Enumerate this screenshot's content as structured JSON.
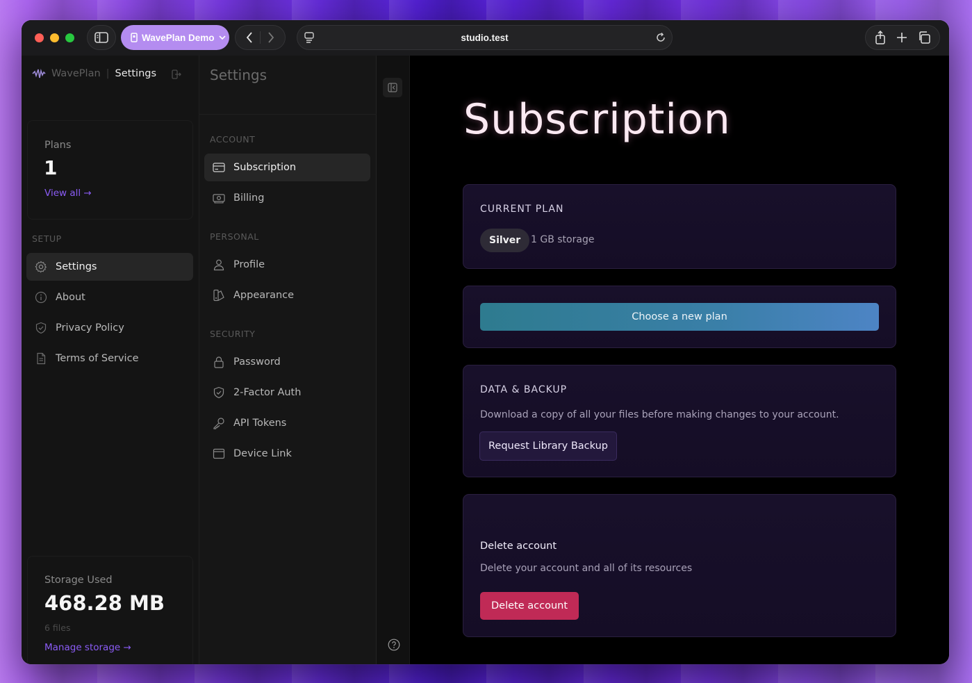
{
  "browser": {
    "tab_group_label": "WavePlan Demo",
    "url": "studio.test"
  },
  "brand": {
    "app_name": "WavePlan",
    "separator": "|",
    "section": "Settings"
  },
  "plans_card": {
    "label": "Plans",
    "value": "1",
    "link": "View all →"
  },
  "setup": {
    "heading": "SETUP",
    "items": [
      {
        "label": "Settings",
        "icon": "gear-icon",
        "active": true
      },
      {
        "label": "About",
        "icon": "info-icon"
      },
      {
        "label": "Privacy Policy",
        "icon": "shield-icon"
      },
      {
        "label": "Terms of Service",
        "icon": "document-icon"
      }
    ]
  },
  "storage_card": {
    "label": "Storage Used",
    "value": "468.28 MB",
    "files": "6 files",
    "link": "Manage storage →"
  },
  "settings_nav": {
    "title": "Settings",
    "account_heading": "ACCOUNT",
    "account_items": [
      {
        "label": "Subscription",
        "icon": "card-icon",
        "active": true
      },
      {
        "label": "Billing",
        "icon": "cash-icon"
      }
    ],
    "personal_heading": "PERSONAL",
    "personal_items": [
      {
        "label": "Profile",
        "icon": "user-icon"
      },
      {
        "label": "Appearance",
        "icon": "palette-icon"
      }
    ],
    "security_heading": "SECURITY",
    "security_items": [
      {
        "label": "Password",
        "icon": "lock-icon"
      },
      {
        "label": "2-Factor Auth",
        "icon": "shield-check-icon"
      },
      {
        "label": "API Tokens",
        "icon": "key-icon"
      },
      {
        "label": "Device Link",
        "icon": "window-icon"
      }
    ]
  },
  "main": {
    "title": "Subscription",
    "current_plan": {
      "heading": "CURRENT PLAN",
      "plan_name": "Silver",
      "plan_note": "1 GB storage"
    },
    "choose_button": "Choose a new plan",
    "backup": {
      "heading": "DATA & BACKUP",
      "description": "Download a copy of all your files before making changes to your account.",
      "button": "Request Library Backup"
    },
    "delete": {
      "heading": "Delete account",
      "description": "Delete your account and all of its resources",
      "button": "Delete account"
    }
  },
  "colors": {
    "accent": "#8b5cf6",
    "danger": "#c02a56",
    "tab_group": "#b48cf0"
  }
}
